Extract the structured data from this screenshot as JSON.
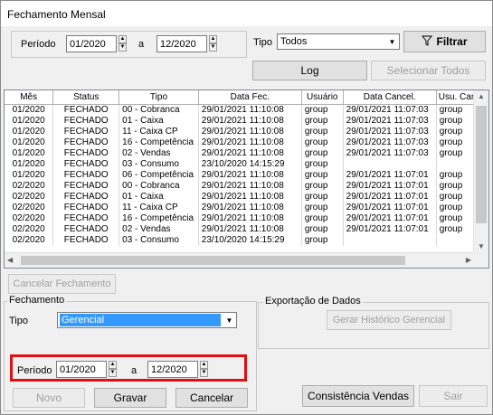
{
  "window": {
    "title": "Fechamento Mensal"
  },
  "filter": {
    "period_label": "Período",
    "from": "01/2020",
    "to_label": "a",
    "to": "12/2020",
    "type_label": "Tipo",
    "type_value": "Todos",
    "filter_button": "Filtrar",
    "log_button": "Log",
    "select_all_button": "Selecionar Todos"
  },
  "grid": {
    "columns": [
      "Mês",
      "Status",
      "Tipo",
      "Data Fec.",
      "Usuário",
      "Data Cancel.",
      "Usu. Cance"
    ],
    "rows": [
      [
        "01/2020",
        "FECHADO",
        "00 - Cobranca",
        "29/01/2021 11:10:08",
        "group",
        "29/01/2021 11:07:03",
        "group"
      ],
      [
        "01/2020",
        "FECHADO",
        "01 - Caixa",
        "29/01/2021 11:10:08",
        "group",
        "29/01/2021 11:07:03",
        "group"
      ],
      [
        "01/2020",
        "FECHADO",
        "11 - Caixa CP",
        "29/01/2021 11:10:08",
        "group",
        "29/01/2021 11:07:03",
        "group"
      ],
      [
        "01/2020",
        "FECHADO",
        "16 - Competência",
        "29/01/2021 11:10:08",
        "group",
        "29/01/2021 11:07:03",
        "group"
      ],
      [
        "01/2020",
        "FECHADO",
        "02 - Vendas",
        "29/01/2021 11:10:08",
        "group",
        "29/01/2021 11:07:03",
        "group"
      ],
      [
        "01/2020",
        "FECHADO",
        "03 - Consumo",
        "23/10/2020 14:15:29",
        "group",
        "",
        ""
      ],
      [
        "01/2020",
        "FECHADO",
        "06 - Competência",
        "29/01/2021 11:10:08",
        "group",
        "29/01/2021 11:07:01",
        "group"
      ],
      [
        "02/2020",
        "FECHADO",
        "00 - Cobranca",
        "29/01/2021 11:10:08",
        "group",
        "29/01/2021 11:07:01",
        "group"
      ],
      [
        "02/2020",
        "FECHADO",
        "01 - Caixa",
        "29/01/2021 11:10:08",
        "group",
        "29/01/2021 11:07:01",
        "group"
      ],
      [
        "02/2020",
        "FECHADO",
        "11 - Caixa CP",
        "29/01/2021 11:10:08",
        "group",
        "29/01/2021 11:07:01",
        "group"
      ],
      [
        "02/2020",
        "FECHADO",
        "16 - Competência",
        "29/01/2021 11:10:08",
        "group",
        "29/01/2021 11:07:01",
        "group"
      ],
      [
        "02/2020",
        "FECHADO",
        "02 - Vendas",
        "29/01/2021 11:10:08",
        "group",
        "29/01/2021 11:07:01",
        "group"
      ],
      [
        "02/2020",
        "FECHADO",
        "03 - Consumo",
        "23/10/2020 14:15:29",
        "group",
        "",
        ""
      ]
    ]
  },
  "cancel_closing_button": "Cancelar Fechamento",
  "closing": {
    "group_label": "Fechamento",
    "type_label": "Tipo",
    "type_value": "Gerencial",
    "period_label": "Período",
    "from": "01/2020",
    "to_label": "a",
    "to": "12/2020",
    "new_button": "Novo",
    "save_button": "Gravar",
    "cancel_button": "Cancelar"
  },
  "export": {
    "group_label": "Exportação de Dados",
    "history_button": "Gerar Histórico Gerencial"
  },
  "footer": {
    "consistency_button": "Consistência Vendas",
    "exit_button": "Sair"
  },
  "colors": {
    "selection": "#3399ff",
    "highlight_box": "#e01010"
  }
}
